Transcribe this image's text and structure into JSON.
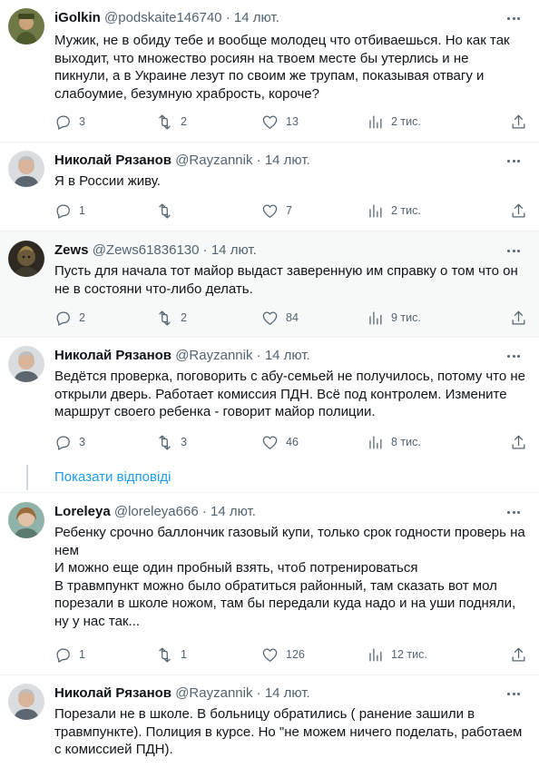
{
  "icons": {
    "reply": "speech-bubble-icon",
    "retweet": "retweet-arrows-icon",
    "like": "heart-icon",
    "views": "bar-chart-icon",
    "share": "share-upload-icon",
    "more": "more-dots-icon"
  },
  "colors": {
    "link": "#1d9bf0",
    "secondary_text": "#536471",
    "highlight_bg": "#f7f9f9"
  },
  "tweets": [
    {
      "name": "iGolkin",
      "handle": "@podskaite146740",
      "dot": "·",
      "date": "14 лют.",
      "text": "Мужик, не в обиду тебе и вообще молодец что отбиваешься. Но как так выходит, что множество росиян на твоем месте бы утерлись и не пикнули, а в Украине лезут по своим же трупам, показывая отвагу и слабоумие, безумную храбрость, короче?",
      "replies": "3",
      "retweets": "2",
      "likes": "13",
      "views": "2 тис."
    },
    {
      "name": "Николай Рязанов",
      "handle": "@Rayzannik",
      "dot": "·",
      "date": "14 лют.",
      "text": "Я в России живу.",
      "replies": "1",
      "retweets": "",
      "likes": "7",
      "views": "2 тис."
    },
    {
      "name": "Zews",
      "handle": "@Zews61836130",
      "dot": "·",
      "date": "14 лют.",
      "text": "Пусть для начала тот майор выдаст заверенную им справку о том что он не в состояни что-либо делать.",
      "replies": "2",
      "retweets": "2",
      "likes": "84",
      "views": "9 тис."
    },
    {
      "name": "Николай Рязанов",
      "handle": "@Rayzannik",
      "dot": "·",
      "date": "14 лют.",
      "text": "Ведётся проверка, поговорить с абу-семьей не получилось, потому что не открыли дверь. Работает комиссия ПДН. Всё под контролем. Измените маршрут своего ребенка - говорит майор полиции.",
      "replies": "3",
      "retweets": "3",
      "likes": "46",
      "views": "8 тис."
    },
    {
      "name": "Loreleya",
      "handle": "@loreleya666",
      "dot": "·",
      "date": "14 лют.",
      "text": "Ребенку срочно баллончик газовый купи, только срок годности проверь на нем\nИ можно еще один пробный взять, чтоб потренироваться\nВ травмпункт можно было обратиться районный, там сказать вот мол порезали в школе ножом, там бы передали куда надо и на уши подняли, ну у нас так...",
      "replies": "1",
      "retweets": "1",
      "likes": "126",
      "views": "12 тис."
    },
    {
      "name": "Николай Рязанов",
      "handle": "@Rayzannik",
      "dot": "·",
      "date": "14 лют.",
      "text": "Порезали не в школе. В больницу обратились ( ранение зашили в травмпункте). Полиция в курсе. Но \"не можем ничего поделать, работаем с комиссией ПДН)."
    }
  ],
  "show_replies_label": "Показати відповіді"
}
